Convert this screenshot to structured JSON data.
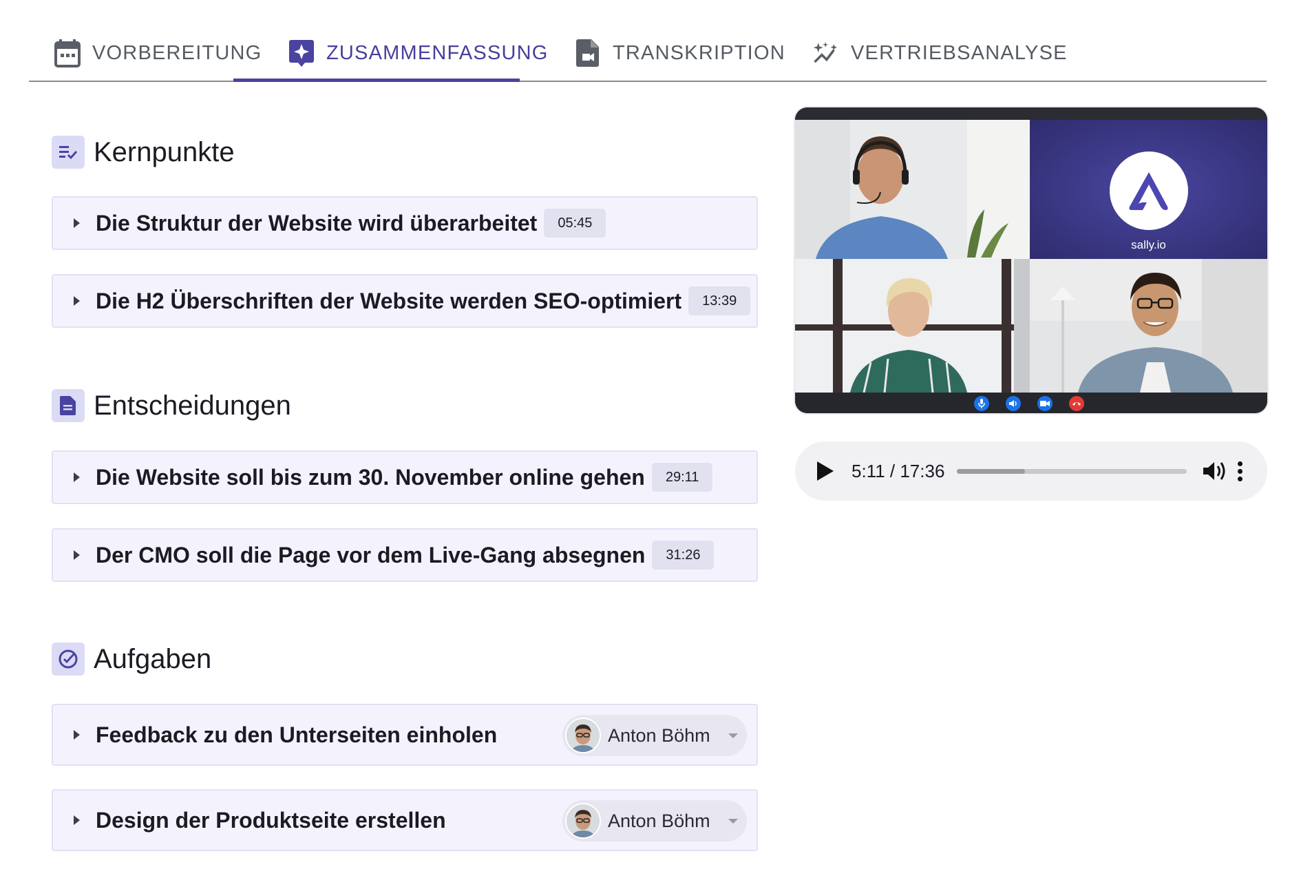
{
  "tabs": [
    {
      "label": "VORBEREITUNG",
      "icon": "calendar-icon",
      "active": false
    },
    {
      "label": "ZUSAMMENFASSUNG",
      "icon": "sparkle-note-icon",
      "active": true
    },
    {
      "label": "TRANSKRIPTION",
      "icon": "video-file-icon",
      "active": false
    },
    {
      "label": "VERTRIEBSANALYSE",
      "icon": "sparkle-chart-icon",
      "active": false
    }
  ],
  "sections": {
    "kernpunkte": {
      "title": "Kernpunkte",
      "items": [
        {
          "text": "Die Struktur der Website wird überarbeitet",
          "time": "05:45"
        },
        {
          "text": "Die H2 Überschriften der Website werden SEO-optimiert",
          "time": "13:39"
        }
      ]
    },
    "entscheidungen": {
      "title": "Entscheidungen",
      "items": [
        {
          "text": "Die Website soll bis zum 30. November online gehen",
          "time": "29:11"
        },
        {
          "text": "Der CMO soll die Page vor dem Live-Gang absegnen",
          "time": "31:26"
        }
      ]
    },
    "aufgaben": {
      "title": "Aufgaben",
      "items": [
        {
          "text": "Feedback zu den Unterseiten einholen",
          "assignee": "Anton Böhm"
        },
        {
          "text": "Design der Produktseite erstellen",
          "assignee": "Anton Böhm"
        }
      ]
    }
  },
  "video": {
    "logo_text": "sally.io"
  },
  "player": {
    "time": "5:11 / 17:36",
    "progress": 0.295
  },
  "colors": {
    "accent": "#463f9c",
    "item_bg": "#f4f3fd",
    "section_icon_bg": "#dcdbf6"
  }
}
